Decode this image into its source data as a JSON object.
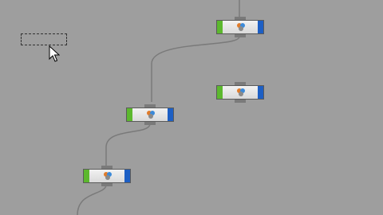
{
  "canvas": {
    "background": "#9e9e9e",
    "wire_color": "#7a7a7a"
  },
  "nodes": [
    {
      "id": "node-1",
      "left_flag_color": "#5cb82e",
      "right_flag_color": "#1d5fc4",
      "icon": "node-type-icon"
    },
    {
      "id": "node-2",
      "left_flag_color": "#5cb82e",
      "right_flag_color": "#1d5fc4",
      "icon": "node-type-icon"
    },
    {
      "id": "node-3",
      "left_flag_color": "#5cb82e",
      "right_flag_color": "#1d5fc4",
      "icon": "node-type-icon"
    },
    {
      "id": "node-4",
      "left_flag_color": "#5cb82e",
      "right_flag_color": "#1d5fc4",
      "icon": "node-type-icon"
    }
  ],
  "selection": {
    "icon": "marquee-selection"
  },
  "pointer": {
    "icon": "arrow-cursor-icon"
  }
}
